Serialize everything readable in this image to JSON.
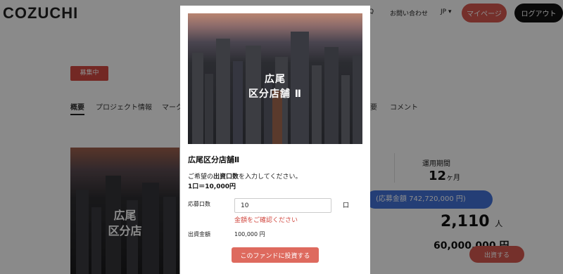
{
  "header": {
    "logo": "COZUCHI",
    "faq": "Q",
    "contact": "お問い合わせ",
    "lang": "JP ▾",
    "mypage": "マイページ",
    "logout": "ログアウト"
  },
  "page": {
    "status_badge": "募集中",
    "tabs": [
      "概要",
      "プロジェクト情報",
      "マーク",
      "要",
      "コメント"
    ],
    "hero_title_line1": "広尾",
    "hero_title_line2": "区分店",
    "stat_left_fragment": ")",
    "term_label": "運用期間",
    "term_value": "12",
    "term_unit": "ヶ月",
    "raise_bar": "(応募金額 742,720,000 円)",
    "applicants_value": "2,110",
    "applicants_unit": "人",
    "amount_value": "60,000,000",
    "amount_unit": "円",
    "invest_button": "出資する"
  },
  "modal": {
    "image_title_line1": "広尾",
    "image_title_line2": "区分店舗 Ⅱ",
    "fund_name": "広尾区分店舗Ⅱ",
    "instruction_prefix": "ご希望の",
    "instruction_bold": "出資口数",
    "instruction_suffix": "を入力してください。",
    "unit_price": "1口＝10,000円",
    "units_label": "応募口数",
    "units_value": "10",
    "units_suffix": "口",
    "units_error": "金額をご確認ください",
    "amount_label": "出資金額",
    "amount_value": "100,000 円",
    "invest_button": "このファンドに投資する"
  },
  "colors": {
    "accent_red": "#d6584f",
    "accent_blue": "#4272d8",
    "error": "#d24a42"
  }
}
